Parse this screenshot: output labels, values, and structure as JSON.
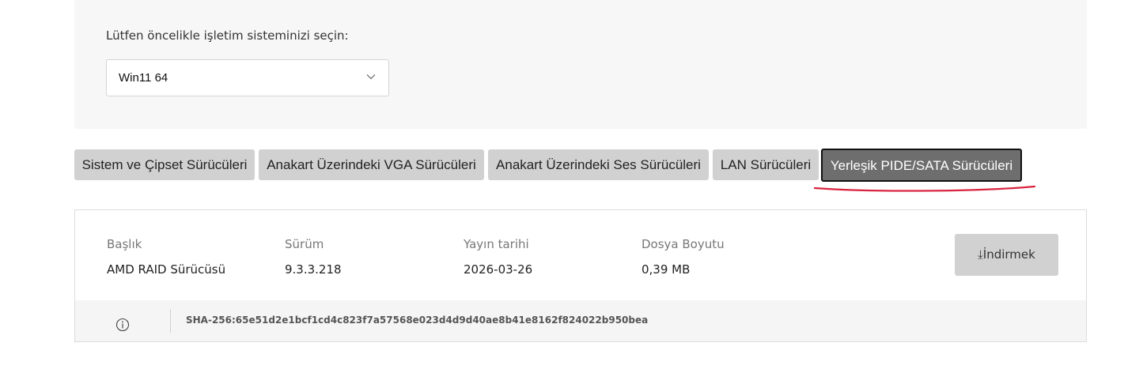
{
  "os_selector": {
    "label": "Lütfen öncelikle işletim sisteminizi seçin:",
    "selected": "Win11 64"
  },
  "tabs": [
    {
      "label": "Sistem ve Çipset Sürücüleri",
      "active": false
    },
    {
      "label": "Anakart Üzerindeki VGA Sürücüleri",
      "active": false
    },
    {
      "label": "Anakart Üzerindeki Ses Sürücüleri",
      "active": false
    },
    {
      "label": "LAN Sürücüleri",
      "active": false
    },
    {
      "label": "Yerleşik PIDE/SATA Sürücüleri",
      "active": true
    }
  ],
  "driver": {
    "headers": {
      "title": "Başlık",
      "version": "Sürüm",
      "release_date": "Yayın tarihi",
      "file_size": "Dosya Boyutu"
    },
    "values": {
      "title": "AMD RAID Sürücüsü",
      "version": "9.3.3.218",
      "release_date": "2026-03-26",
      "file_size": "0,39 MB"
    },
    "download_label": "⤓İndirmek",
    "hash": "SHA-256:65e51d2e1bcf1cd4c823f7a57568e023d4d9d40ae8b41e8162f824022b950bea"
  },
  "colors": {
    "active_tab": "#6e6e6e",
    "inactive_tab": "#d1d1d1",
    "annotation": "#d9233f"
  },
  "icons": {
    "select": "chevron-down-icon",
    "info": "info-icon"
  }
}
